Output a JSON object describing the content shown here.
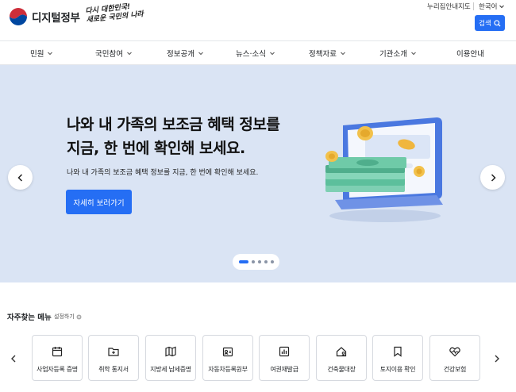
{
  "header": {
    "logo_text": "디지털정부",
    "slogan_line1": "다시 대한민국!",
    "slogan_line2": "새로운 국민의 나라",
    "utility_link": "누리집안내지도",
    "language": "한국어",
    "search_label": "검색"
  },
  "gnb": {
    "items": [
      {
        "label": "민원",
        "has_dropdown": true
      },
      {
        "label": "국민참여",
        "has_dropdown": true
      },
      {
        "label": "정보공개",
        "has_dropdown": true
      },
      {
        "label": "뉴스·소식",
        "has_dropdown": true
      },
      {
        "label": "정책자료",
        "has_dropdown": true
      },
      {
        "label": "기관소개",
        "has_dropdown": true
      },
      {
        "label": "이용안내",
        "has_dropdown": false
      }
    ]
  },
  "banner": {
    "headline_line1": "나와 내 가족의 보조금 혜택 정보를",
    "headline_line2": "지금, 한 번에 확인해 보세요.",
    "subtext": "나와 내 가족의 보조금 혜택 정보를 지금, 한 번에 확인해 보세요.",
    "cta_label": "자세히 보러가기",
    "slide_count": 5,
    "active_slide": 1,
    "background_color": "#dae4f4"
  },
  "quick_menu": {
    "title": "자주찾는 메뉴",
    "settings_label": "설정하기",
    "items": [
      {
        "label": "사업자등록 증명",
        "icon": "calendar-icon"
      },
      {
        "label": "취학 통지서",
        "icon": "folder-plus-icon"
      },
      {
        "label": "지방세 납세증명",
        "icon": "map-icon"
      },
      {
        "label": "자동차등록원부",
        "icon": "id-card-icon"
      },
      {
        "label": "여권재발급",
        "icon": "bar-chart-icon"
      },
      {
        "label": "건축물대장",
        "icon": "house-user-icon"
      },
      {
        "label": "토지이용 확인",
        "icon": "bookmark-icon"
      },
      {
        "label": "건강보험",
        "icon": "heart-pulse-icon"
      }
    ]
  },
  "colors": {
    "primary": "#256ef4",
    "text": "#1e2124"
  }
}
